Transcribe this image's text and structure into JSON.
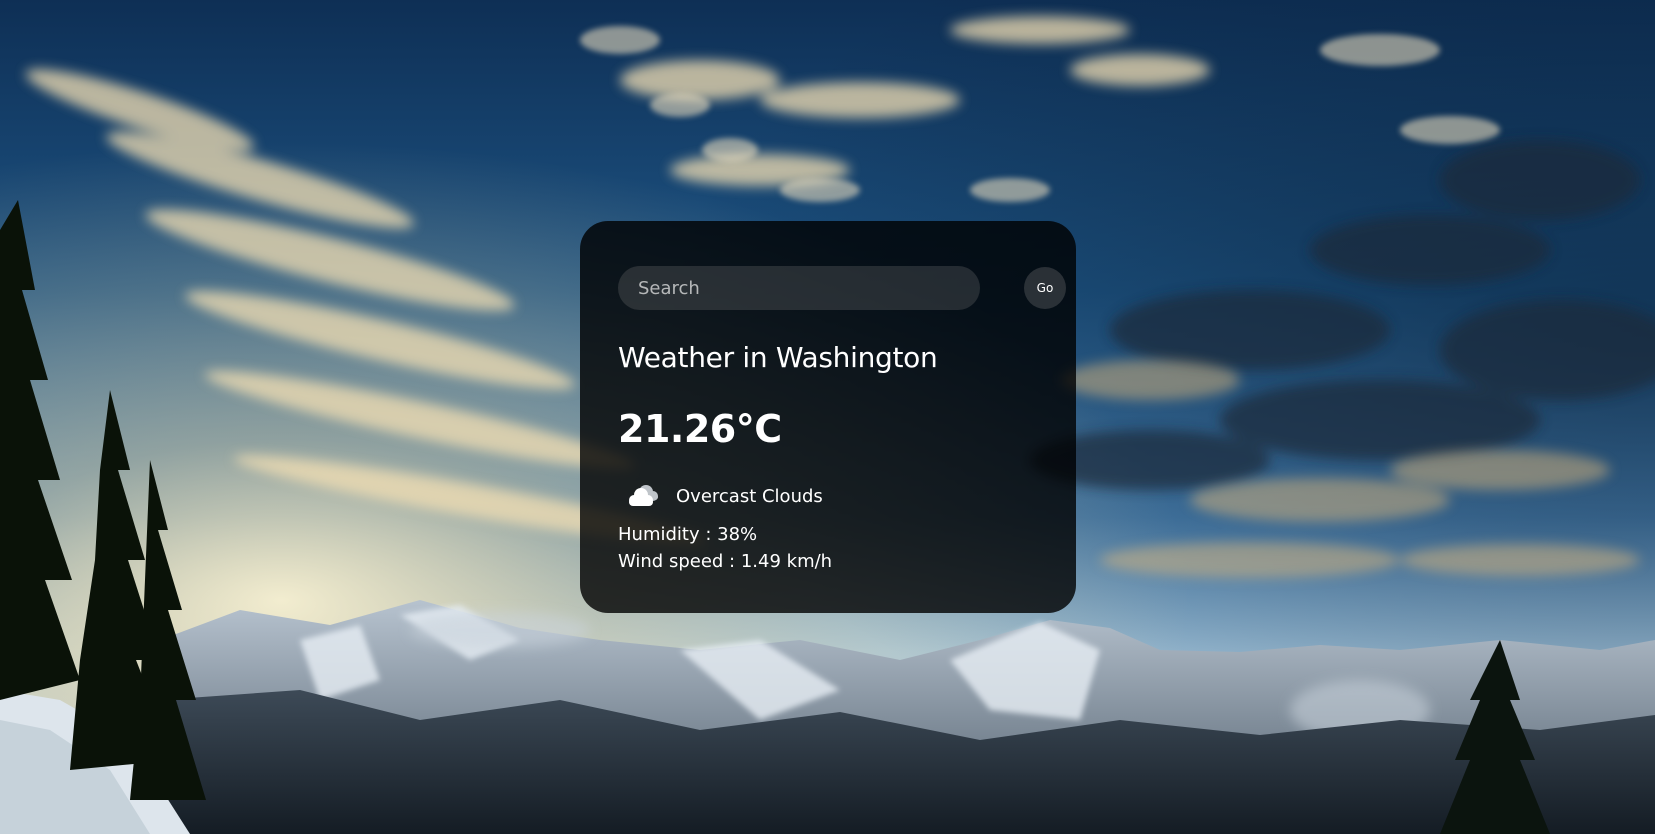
{
  "search": {
    "placeholder": "Search",
    "value": "",
    "button_label": "Go"
  },
  "weather": {
    "title": "Weather in Washington",
    "temperature": "21.26°C",
    "icon": "cloud-icon",
    "description": "Overcast Clouds",
    "humidity_text": "Humidity : 38%",
    "wind_text": "Wind speed : 1.49 km/h"
  },
  "colors": {
    "card_background": "#000000",
    "text": "#ffffff"
  }
}
